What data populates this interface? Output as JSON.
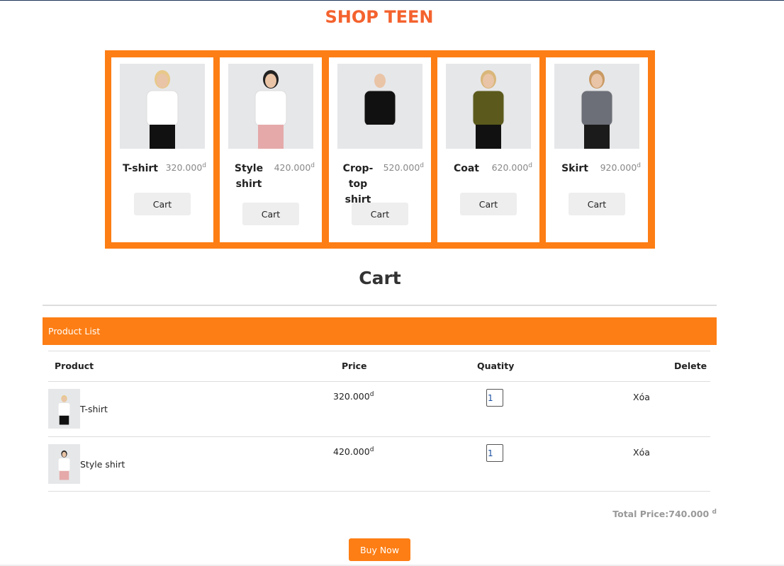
{
  "header": {
    "title": "SHOP TEEN"
  },
  "colors": {
    "accent": "#fd7e14",
    "title": "#f4622e"
  },
  "products": [
    {
      "name": "T-shirt",
      "price": "320.000",
      "currency": "d",
      "cart_label": "Cart",
      "top": "#ffffff",
      "bottom": "#111111",
      "hair": "#e8c98a"
    },
    {
      "name": "Style shirt",
      "price": "420.000",
      "currency": "d",
      "cart_label": "Cart",
      "top": "#ffffff",
      "bottom": "#e5a9a9",
      "hair": "#222222"
    },
    {
      "name": "Crop-top shirt",
      "price": "520.000",
      "currency": "d",
      "cart_label": "Cart",
      "top": "#111111",
      "bottom": "#e6e7e9",
      "hair": "#e6e7e9"
    },
    {
      "name": "Coat",
      "price": "620.000",
      "currency": "d",
      "cart_label": "Cart",
      "top": "#5b5a1c",
      "bottom": "#111111",
      "hair": "#d9b77a"
    },
    {
      "name": "Skirt",
      "price": "920.000",
      "currency": "d",
      "cart_label": "Cart",
      "top": "#6c6f77",
      "bottom": "#1b1b1b",
      "hair": "#c99a63"
    }
  ],
  "cart": {
    "title": "Cart",
    "panel_title": "Product List",
    "columns": [
      "Product",
      "Price",
      "Quatity",
      "Delete"
    ],
    "rows": [
      {
        "product": "T-shirt",
        "price": "320.000",
        "currency": "d",
        "quantity": "1",
        "delete_label": "Xóa"
      },
      {
        "product": "Style shirt",
        "price": "420.000",
        "currency": "d",
        "quantity": "1",
        "delete_label": "Xóa"
      }
    ],
    "total_label": "Total Price:740.000",
    "total_currency": "d",
    "buy_label": "Buy Now"
  }
}
